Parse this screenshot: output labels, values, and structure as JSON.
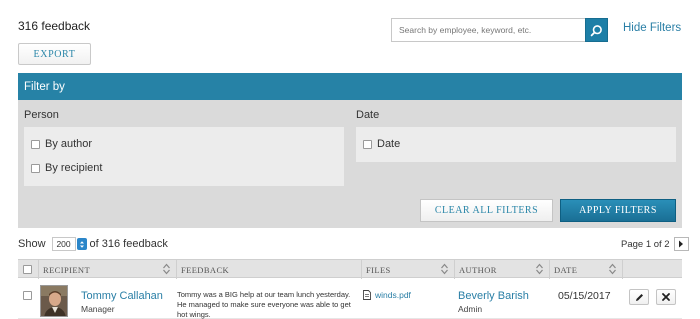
{
  "header": {
    "count_label": "316 feedback",
    "export_label": "EXPORT",
    "hide_filters_label": "Hide Filters"
  },
  "search": {
    "placeholder": "Search by employee, keyword, etc.",
    "value": ""
  },
  "filters": {
    "title": "Filter by",
    "person": {
      "label": "Person",
      "options": [
        {
          "label": "By author",
          "checked": false
        },
        {
          "label": "By recipient",
          "checked": false
        }
      ]
    },
    "date": {
      "label": "Date",
      "options": [
        {
          "label": "Date",
          "checked": false
        }
      ]
    },
    "clear_label": "CLEAR ALL FILTERS",
    "apply_label": "APPLY FILTERS"
  },
  "pagination": {
    "show_label": "Show",
    "per_page": "200",
    "of_label": "of 316 feedback",
    "page_label": "Page 1 of 2"
  },
  "table": {
    "columns": [
      "RECIPIENT",
      "FEEDBACK",
      "FILES",
      "AUTHOR",
      "DATE"
    ],
    "rows": [
      {
        "recipient_name": "Tommy Callahan",
        "recipient_role": "Manager",
        "feedback": "Tommy was a BIG help at our team lunch yesterday. He managed to make sure everyone was able to get hot wings.",
        "file": "winds.pdf",
        "author_name": "Beverly Barish",
        "author_role": "Admin",
        "date": "05/15/2017"
      }
    ]
  },
  "colors": {
    "accent": "#2682a6",
    "link": "#2a7fa6",
    "panel": "#dadada"
  }
}
